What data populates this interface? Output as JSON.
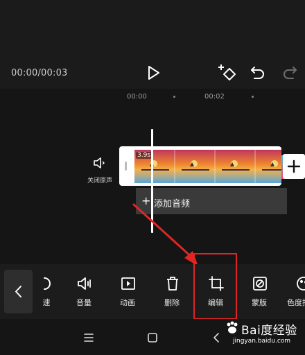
{
  "preview": {
    "time_readout": "00:00/00:03"
  },
  "timeline": {
    "ruler": [
      "00:00",
      "00:02"
    ],
    "mute_label": "关闭原声",
    "clip_duration": "3.9s",
    "add_audio_label": "添加音频"
  },
  "toolbar": {
    "items": [
      {
        "label": "速",
        "icon": "speed-icon"
      },
      {
        "label": "音量",
        "icon": "volume-icon"
      },
      {
        "label": "动画",
        "icon": "animation-icon"
      },
      {
        "label": "删除",
        "icon": "trash-icon"
      },
      {
        "label": "编辑",
        "icon": "crop-icon"
      },
      {
        "label": "蒙版",
        "icon": "mask-icon"
      },
      {
        "label": "色度抠图",
        "icon": "chroma-icon"
      }
    ]
  },
  "watermark": {
    "text": "Bai度经验",
    "url": "jingyan.baidu.com"
  },
  "colors": {
    "background": "#1a1a1a",
    "highlight": "#e02525",
    "annotation_arrow": "#e02525"
  }
}
